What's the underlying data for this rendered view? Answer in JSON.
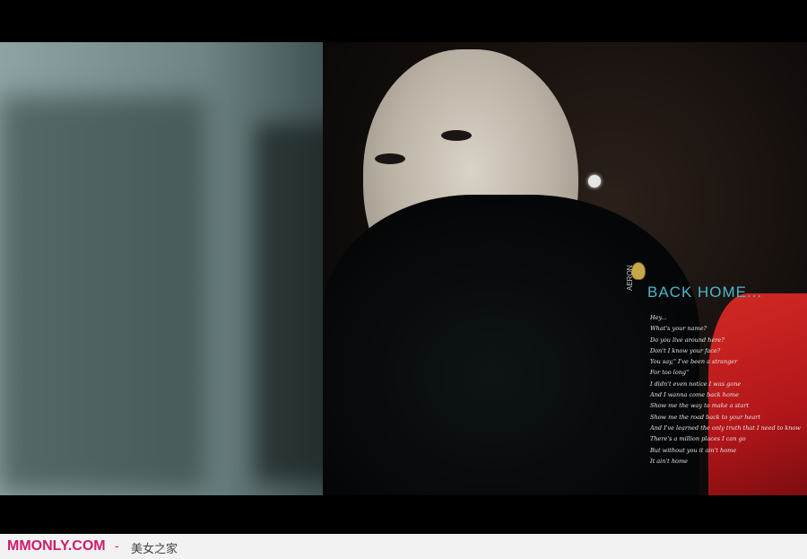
{
  "overlay": {
    "title": "BACK HOME...",
    "brand": "AERON",
    "lyrics": [
      "Hey...",
      "What's your name?",
      "Do you live around here?",
      "Don't I know your face?",
      "You say,\" I've been a stranger",
      "For too long\"",
      "I didn't even notice I was gone",
      "And I wanna come back home",
      "Show me the way to make a start",
      "Show me the road back to your heart",
      "And I've learned the only truth that I need to know",
      "There's a million places I can go",
      "But without you it ain't home",
      "It ain't home"
    ]
  },
  "footer": {
    "site": "MMONLY.COM",
    "separator": "-",
    "slogan": "美女之家"
  },
  "colors": {
    "title": "#49b7c9",
    "site": "#d01b6d",
    "coat": "#c41e1f"
  }
}
